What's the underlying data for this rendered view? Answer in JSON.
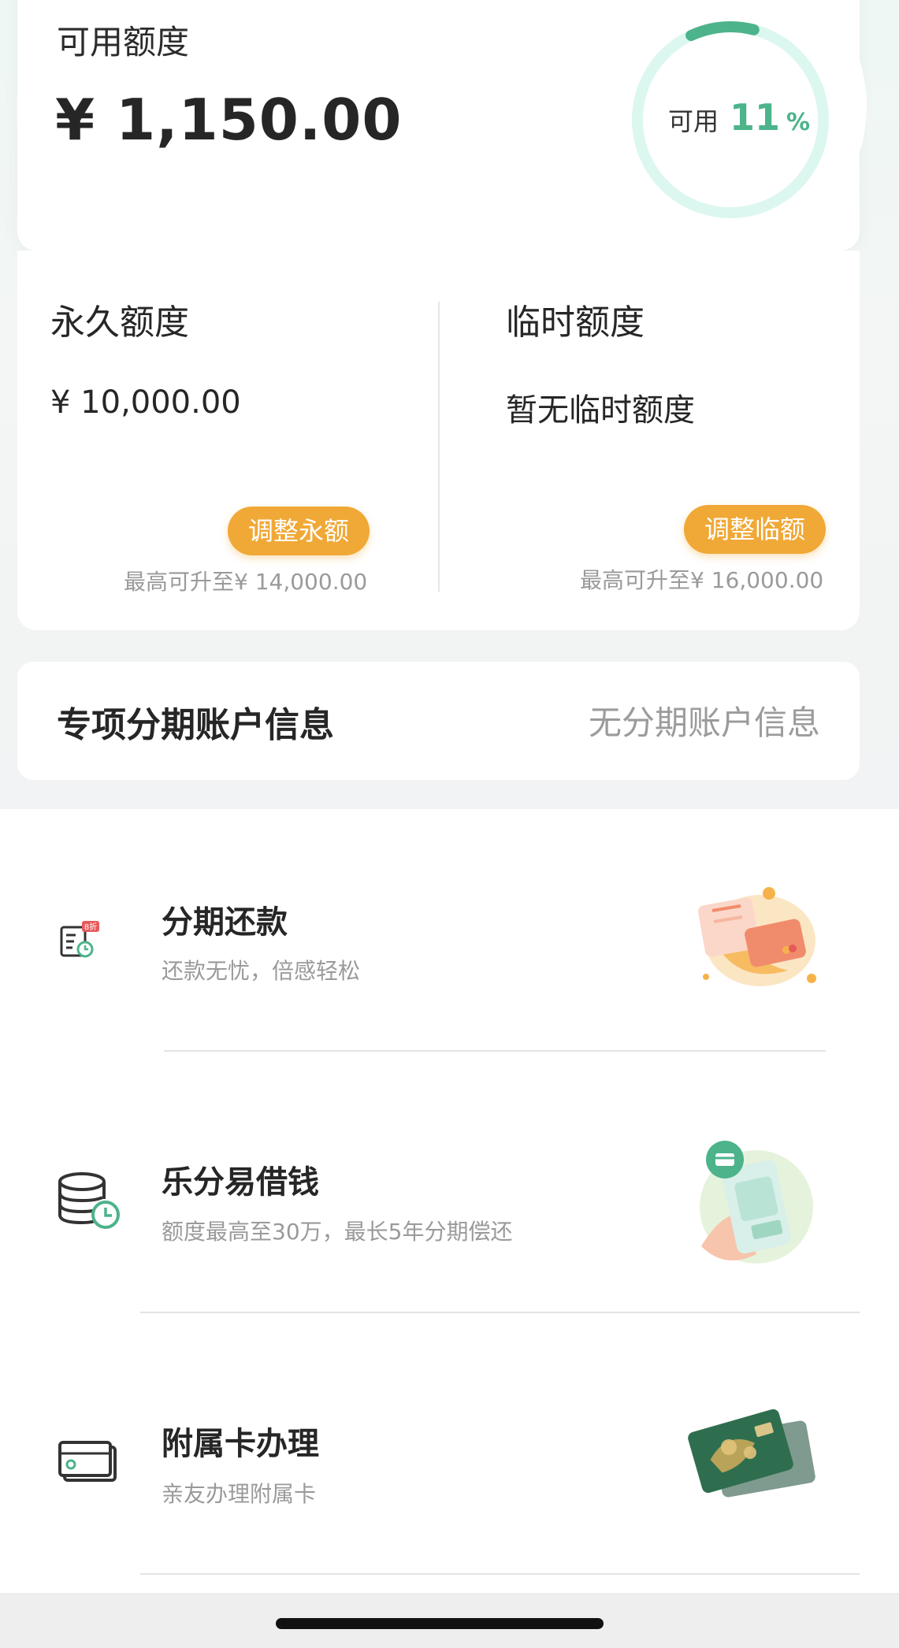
{
  "available": {
    "label": "可用额度",
    "amount": "¥ 1,150.00",
    "ring_label": "可用",
    "ring_percent": "11",
    "ring_unit": "%",
    "ring_fraction": 0.11,
    "accent_color": "#4cb38a",
    "ring_track_color": "#dcf7ef"
  },
  "permanent": {
    "title": "永久额度",
    "value": "¥ 10,000.00",
    "button": "调整永额",
    "note": "最高可升至¥ 14,000.00"
  },
  "temporary": {
    "title": "临时额度",
    "value": "暂无临时额度",
    "button": "调整临额",
    "note": "最高可升至¥ 16,000.00"
  },
  "button_color": "#f0a836",
  "installment_account": {
    "title": "专项分期账户信息",
    "status": "无分期账户信息"
  },
  "services": [
    {
      "title": "分期还款",
      "subtitle": "还款无忧，倍感轻松",
      "icon": "installment-bill-icon",
      "badge": "8折"
    },
    {
      "title": "乐分易借钱",
      "subtitle": "额度最高至30万，最长5年分期偿还",
      "icon": "coin-stack-clock-icon"
    },
    {
      "title": "附属卡办理",
      "subtitle": "亲友办理附属卡",
      "icon": "card-icon"
    }
  ]
}
